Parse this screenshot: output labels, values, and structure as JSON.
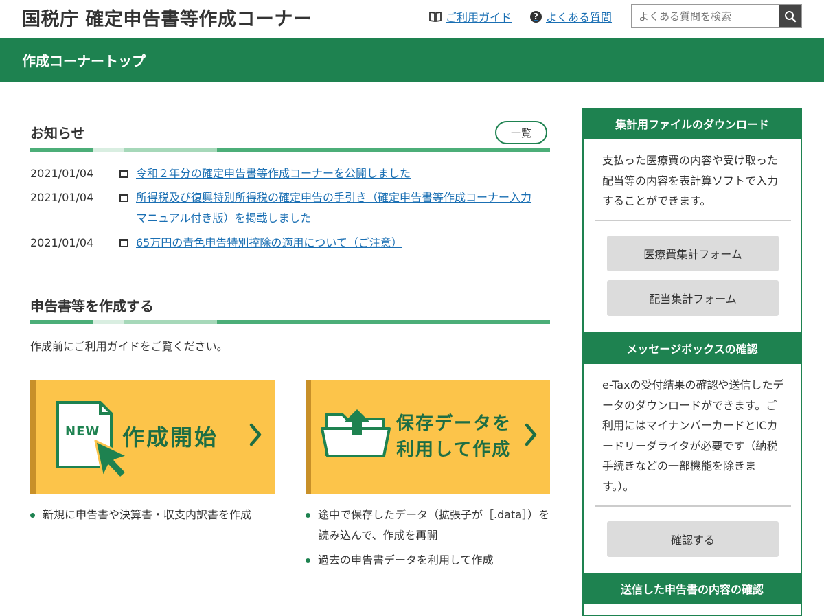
{
  "header": {
    "title": "国税庁 確定申告書等作成コーナー",
    "guide_link": "ご利用ガイド",
    "faq_link": "よくある質問",
    "faq_icon_text": "?",
    "search_placeholder": "よくある質問を検索"
  },
  "topbar": {
    "label": "作成コーナートップ"
  },
  "news": {
    "title": "お知らせ",
    "list_button": "一覧",
    "items": [
      {
        "date": "2021/01/04",
        "text": "令和２年分の確定申告書等作成コーナーを公開しました"
      },
      {
        "date": "2021/01/04",
        "text": "所得税及び復興特別所得税の確定申告の手引き（確定申告書等作成コーナー入力マニュアル付き版）を掲載しました"
      },
      {
        "date": "2021/01/04",
        "text": "65万円の青色申告特別控除の適用について（ご注意）"
      }
    ]
  },
  "create_section": {
    "title": "申告書等を作成する",
    "intro": "作成前にご利用ガイドをご覧ください。",
    "create_button": {
      "badge": "NEW",
      "label": "作成開始"
    },
    "resume_button": {
      "line1": "保存データを",
      "line2": "利用して作成"
    },
    "create_bullets": [
      "新規に申告書や決算書・収支内訳書を作成"
    ],
    "resume_bullets": [
      "途中で保存したデータ（拡張子が［.data］）を読み込んで、作成を再開",
      "過去の申告書データを利用して作成"
    ]
  },
  "sidebar": {
    "download": {
      "title": "集計用ファイルのダウンロード",
      "text": "支払った医療費の内容や受け取った配当等の内容を表計算ソフトで入力することができます。",
      "buttons": [
        "医療費集計フォーム",
        "配当集計フォーム"
      ]
    },
    "messagebox": {
      "title": "メッセージボックスの確認",
      "text": "e-Taxの受付結果の確認や送信したデータのダウンロードができます。ご利用にはマイナンバーカードとICカードリーダライタが必要です（納税手続きなどの一部機能を除きます。）。",
      "button": "確認する"
    },
    "sent": {
      "title": "送信した申告書の内容の確認"
    }
  },
  "colors": {
    "brand_green": "#1e8250",
    "button_yellow": "#fcc44a",
    "link_blue": "#1a6fb3"
  }
}
